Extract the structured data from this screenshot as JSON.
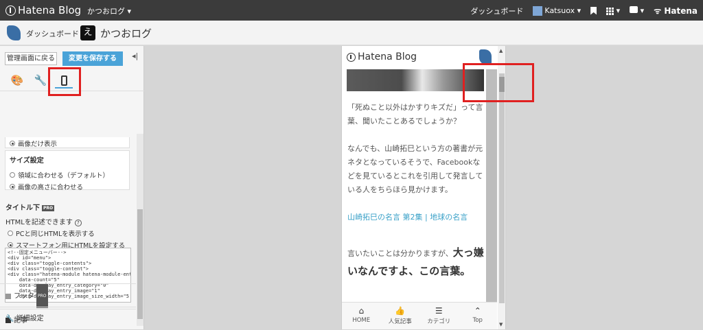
{
  "topbar": {
    "logo": "Hatena Blog",
    "blog_selector": "かつおログ",
    "dashboard": "ダッシュボード",
    "user": "Katsuox",
    "hatena": "Hatena"
  },
  "subbar": {
    "dashboard": "ダッシュボード",
    "blog_icon": "え",
    "blog_name": "かつおログ"
  },
  "panel": {
    "back_button": "管理画面に戻る",
    "save_button": "変更を保存する",
    "collapse": "◂|",
    "image_only": "画像だけ表示",
    "size_title": "サイズ設定",
    "size_options": [
      "領域に合わせる（デフォルト）",
      "画像の高さに合わせる"
    ],
    "title_below": "タイトル下",
    "pro": "PRO",
    "html_note": "HTMLを記述できます",
    "help": "?",
    "html_options": [
      "PCと同じHTMLを表示する",
      "スマートフォン用にHTMLを設定する"
    ],
    "code": "<!--固定メニューバー-->\n<div id=\"menu\">\n<div class=\"toggle-contents\">\n<div class=\"toggle-content\">\n<div class=\"hatena-module hatena-module-ent\n    data-count=\"5\"\n    data-display_entry_category=\"0\"\n    data-display_entry_image=\"1\"\n    data-display_entry_image_size_width=\"5",
    "sections": [
      "記事",
      "フッタ",
      "詳細設定"
    ]
  },
  "phone": {
    "logo": "Hatena Blog",
    "p1": "「死ぬこと以外はかすりキズだ」って言葉、聞いたことあるでしょうか？",
    "p2": "なんでも、山崎拓巳という方の著書が元ネタとなっているそうで、Facebookなどを見ているとこれを引用して発言している人をちらほら見かけます。",
    "link": "山崎拓巳の名言 第2集 | 地球の名言",
    "p3a": "言いたいことは分かりますが、",
    "p3b": "大っ嫌いなんですよ、この言葉。",
    "nav": [
      {
        "label": "HOME",
        "icon": "⌂"
      },
      {
        "label": "人気記事",
        "icon": "👍"
      },
      {
        "label": "カテゴリ",
        "icon": "☰"
      },
      {
        "label": "Top",
        "icon": "⌃"
      }
    ]
  }
}
